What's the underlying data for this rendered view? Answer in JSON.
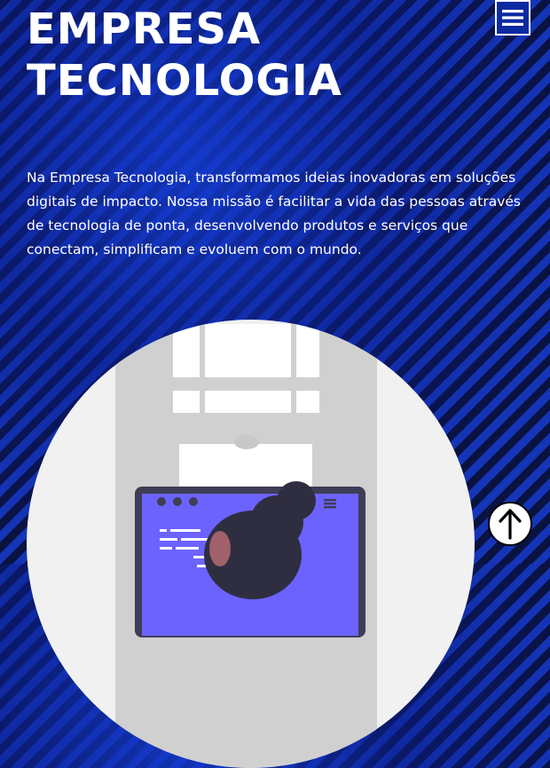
{
  "hero": {
    "title_line1": "EMPRESA",
    "title_line2": "TECNOLOGIA",
    "description": "Na Empresa Tecnologia, transformamos ideias inovadoras em soluções digitais de impacto. Nossa missão é facilitar a vida das pessoas através de tecnologia de ponta, desenvolvendo produtos e serviços que conectam, simplificam e evoluem com o mundo."
  },
  "icons": {
    "menu": "hamburger-menu-icon",
    "scroll_top": "arrow-up-icon"
  },
  "colors": {
    "background_dark": "#0a1240",
    "background_stripe": "#1535b8",
    "text": "#ffffff",
    "illustration_circle": "#f1f1f1",
    "laptop_accent": "#6c63ff"
  }
}
